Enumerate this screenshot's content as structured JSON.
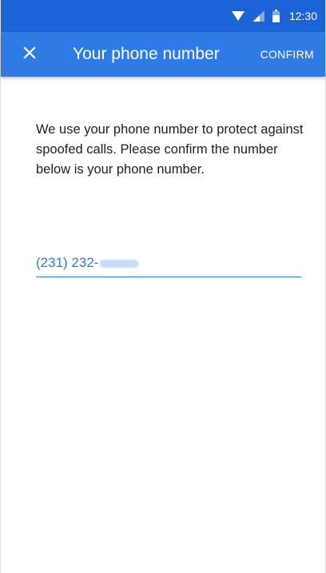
{
  "status_bar": {
    "time": "12:30",
    "icons": [
      "wifi-icon",
      "cellular-signal-icon",
      "battery-icon"
    ]
  },
  "app_bar": {
    "close_icon": "close-icon",
    "title": "Your phone number",
    "confirm_label": "CONFIRM"
  },
  "content": {
    "description": "We use your phone number to protect against spoofed calls. Please confirm the number below is your phone number."
  },
  "phone_field": {
    "value": "(231) 232-"
  },
  "colors": {
    "status_bar": "#1a64d8",
    "app_bar": "#2f7be6",
    "accent": "#2f7be6",
    "text": "#212121"
  }
}
